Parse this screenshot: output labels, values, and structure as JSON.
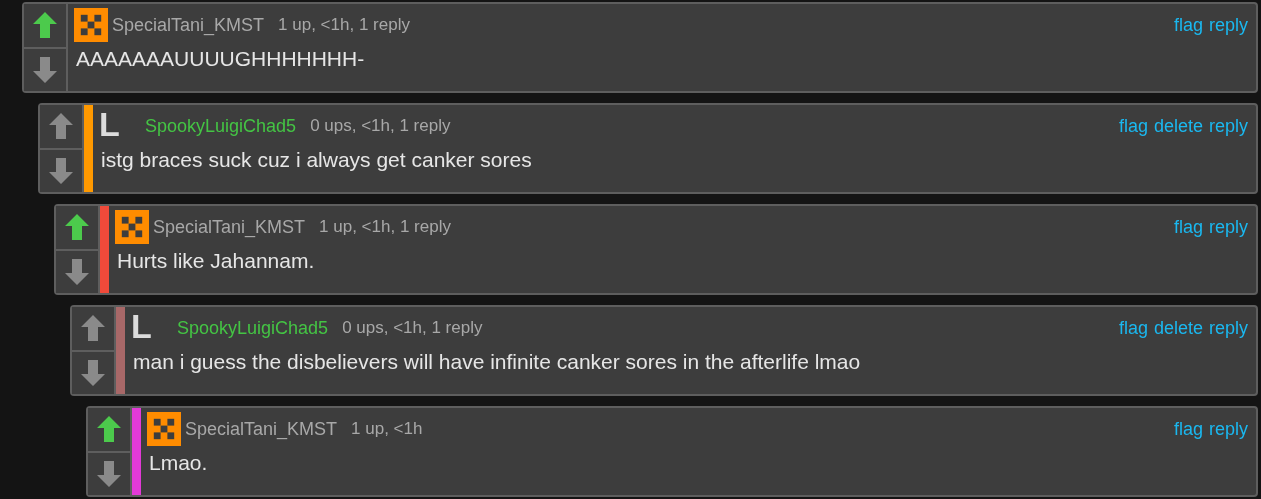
{
  "comments": [
    {
      "upvoted": true,
      "avatar": {
        "kind": "checker"
      },
      "user": {
        "name": "SpecialTani_KMST",
        "color": "#a8a8a8"
      },
      "meta": "1 up, <1h, 1 reply",
      "actions": [
        "flag",
        "reply"
      ],
      "text": "AAAAAAAUUUUGHHHHHHH-",
      "children": [
        {
          "upvoted": false,
          "color": "#ff9900",
          "avatar": {
            "kind": "letter",
            "text": "L"
          },
          "user": {
            "name": "SpookyLuigiChad5",
            "color": "#44c444"
          },
          "meta": "0 ups, <1h, 1 reply",
          "actions": [
            "flag",
            "delete",
            "reply"
          ],
          "text": "istg braces suck cuz i always get canker sores",
          "children": [
            {
              "upvoted": true,
              "color": "#f04a3a",
              "avatar": {
                "kind": "checker"
              },
              "user": {
                "name": "SpecialTani_KMST",
                "color": "#a8a8a8"
              },
              "meta": "1 up, <1h, 1 reply",
              "actions": [
                "flag",
                "reply"
              ],
              "text": "Hurts like Jahannam.",
              "children": [
                {
                  "upvoted": false,
                  "color": "#a86868",
                  "avatar": {
                    "kind": "letter",
                    "text": "L"
                  },
                  "user": {
                    "name": "SpookyLuigiChad5",
                    "color": "#44c444"
                  },
                  "meta": "0 ups, <1h, 1 reply",
                  "actions": [
                    "flag",
                    "delete",
                    "reply"
                  ],
                  "text": "man i guess the disbelievers will have infinite canker sores in the afterlife lmao",
                  "children": [
                    {
                      "upvoted": true,
                      "color": "#e33ad8",
                      "avatar": {
                        "kind": "checker"
                      },
                      "user": {
                        "name": "SpecialTani_KMST",
                        "color": "#a8a8a8"
                      },
                      "meta": "1 up, <1h",
                      "actions": [
                        "flag",
                        "reply"
                      ],
                      "text": "Lmao."
                    }
                  ]
                }
              ]
            }
          ]
        }
      ]
    }
  ]
}
